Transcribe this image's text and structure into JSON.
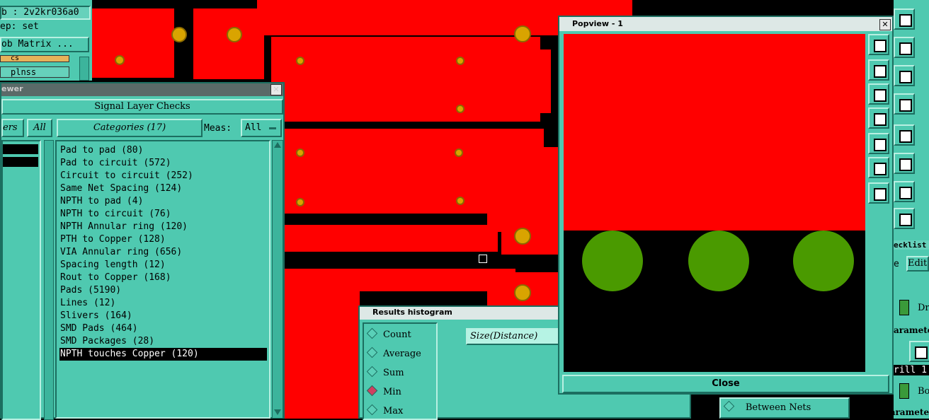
{
  "topleft": {
    "job_label": "b : 2v2kr036a0",
    "step_label": "ep: set",
    "matrix_button": "ob Matrix ...",
    "layer_cs": "cs",
    "layer_plnss": "plnss"
  },
  "viewer": {
    "title": "ewer",
    "header": "Signal Layer Checks",
    "layers_button": "ers",
    "all_button": "All",
    "categories_label": "Categories (17)",
    "meas_label": "Meas:",
    "meas_value": "All",
    "categories": [
      "Pad to pad (80)",
      "Pad to circuit (572)",
      "Circuit to circuit (252)",
      "Same Net Spacing (124)",
      "NPTH to pad (4)",
      "NPTH to circuit (76)",
      "NPTH Annular ring (120)",
      "PTH to Copper (128)",
      "VIA Annular ring (656)",
      "Spacing length (12)",
      "Rout to Copper (168)",
      "Pads (5190)",
      "Lines (12)",
      "Slivers (164)",
      "SMD Pads (464)",
      "SMD Packages (28)",
      "NPTH touches Copper (120)"
    ],
    "selected_index": 16
  },
  "histogram": {
    "title": "Results histogram",
    "options": [
      "Count",
      "Average",
      "Sum",
      "Min",
      "Max"
    ],
    "selected": "Min",
    "field_value": "Size(Distance)"
  },
  "popview": {
    "title": "Popview - 1",
    "close_label": "Close"
  },
  "right": {
    "checklist_label": "ecklist",
    "menu_e": "e",
    "menu_edit": "Edit",
    "dr_label": "Dr",
    "parameters_label": "arameter",
    "drill_value": "rill 1",
    "bo_label": "Bo",
    "between_nets": "Between Nets",
    "parameters_bottom": "Paramete"
  },
  "colors": {
    "panel": "#4fc9b0",
    "copper": "#ff0000",
    "pad": "#d9a400",
    "green_pad": "#4a9a00",
    "selection": "#000000"
  }
}
